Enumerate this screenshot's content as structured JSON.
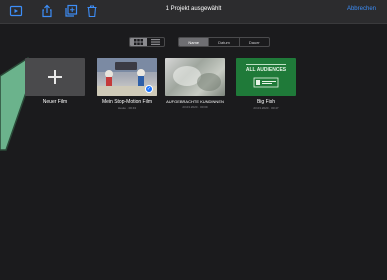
{
  "colors": {
    "background": "#1b1b1d",
    "toolbar": "#2c2c2e",
    "accent": "#3d8ef8",
    "tip_arrow": "#6bb38c"
  },
  "toolbar": {
    "icons": [
      "play-icon",
      "share-icon",
      "duplicate-icon",
      "trash-icon"
    ],
    "title": "1 Projekt ausgewählt",
    "cancel_label": "Abbrechen"
  },
  "view_toggle": {
    "options": [
      "grid-view-icon",
      "list-view-icon"
    ],
    "selected": "grid-view-icon"
  },
  "sort": {
    "options": [
      "Name",
      "Datum",
      "Dauer"
    ],
    "selected": "Name"
  },
  "projects": [
    {
      "title": "Neuer Film",
      "meta": "",
      "icon": "plus-icon"
    },
    {
      "title": "Mein Stop-Motion Film",
      "meta": "Heute · 00:43",
      "selected": true
    },
    {
      "title": "AUFGEBRACHTE KUNDINNEN",
      "meta": "23.03.2020 · 00:09"
    },
    {
      "title": "Big Fish",
      "meta": "23.03.2020 · 00:47",
      "thumb_text": "ALL AUDIENCES"
    }
  ]
}
